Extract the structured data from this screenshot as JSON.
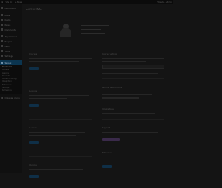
{
  "admin_bar": {
    "site_name": "Site Kit",
    "new_label": "+ New",
    "howdy": "Howdy, admin"
  },
  "sidebar": {
    "items_top": [
      {
        "label": "Dashboard",
        "icon": "dashboard-icon"
      }
    ],
    "items_mid": [
      {
        "label": "Posts",
        "icon": "pin-icon"
      },
      {
        "label": "Media",
        "icon": "media-icon"
      },
      {
        "label": "Pages",
        "icon": "page-icon"
      },
      {
        "label": "Comments",
        "icon": "comment-icon"
      }
    ],
    "items_low": [
      {
        "label": "Appearance",
        "icon": "brush-icon"
      },
      {
        "label": "Plugins",
        "icon": "plugin-icon"
      },
      {
        "label": "Users",
        "icon": "user-icon"
      },
      {
        "label": "Tools",
        "icon": "wrench-icon"
      },
      {
        "label": "Settings",
        "icon": "gear-icon"
      }
    ],
    "active": {
      "label": "Sensei",
      "icon": "sensei-icon"
    },
    "submenu": [
      "Dashboard",
      "Courses",
      "Lessons",
      "Students",
      "Course Ordering",
      "Integrations",
      "Extensions",
      "Settings",
      "Permalinks"
    ],
    "collapse": "Collapse menu"
  },
  "main": {
    "page_title": "Sensei LMS",
    "left_sections": [
      "Courses",
      "Lessons",
      "Learners",
      "Quizzes"
    ],
    "right_sections": [
      "Course Settings",
      "Learner Notifications",
      "Integrations",
      "Support",
      "Extensions"
    ]
  }
}
